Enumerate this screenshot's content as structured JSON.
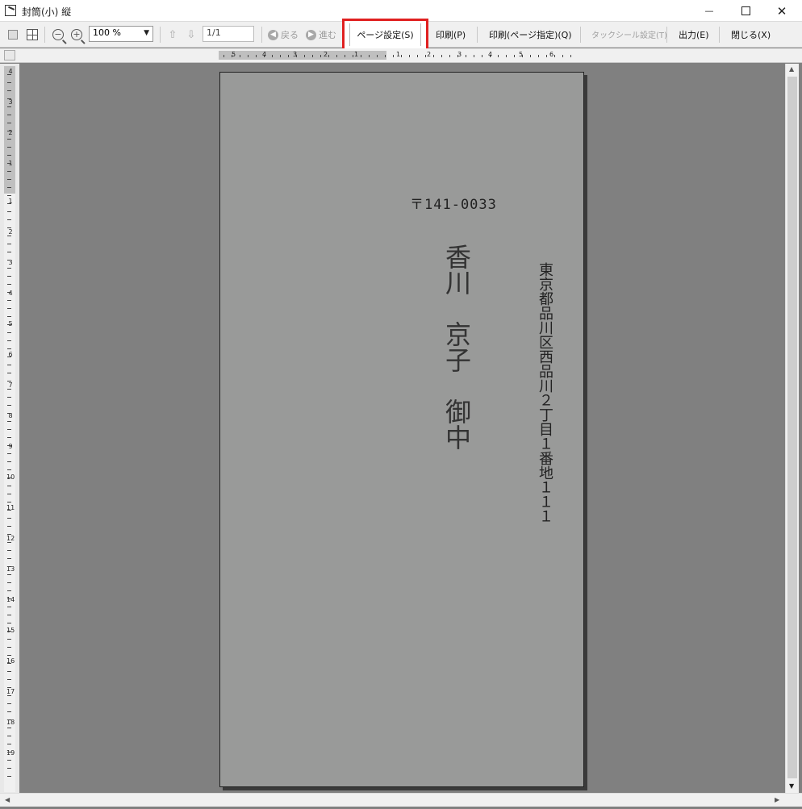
{
  "window": {
    "title": "封筒(小) 縦",
    "minimize": "—",
    "close": "✕"
  },
  "toolbar": {
    "zoom_value": "100 %",
    "page_field": "1/1",
    "back_label": "戻る",
    "forward_label": "進む",
    "page_setup_label": "ページ設定(S)",
    "print_label": "印刷(P)",
    "print_page_label": "印刷(ページ指定)(Q)",
    "tack_seal_label": "タックシール設定(T)",
    "output_label": "出力(E)",
    "close_label": "閉じる(X)"
  },
  "icons": {
    "app": "envelope-app-icon",
    "single_page": "single-page-icon",
    "multi_page": "multi-page-icon",
    "zoom_out": "zoom-out-icon",
    "zoom_in": "zoom-in-icon",
    "prev_page": "prev-page-icon",
    "next_page": "next-page-icon"
  },
  "envelope": {
    "postal_code": "〒141-0033",
    "address": "東京都品川区西品川２丁目１番地１１１",
    "name": "香川　京子　御中"
  },
  "colors": {
    "highlight": "#e02020",
    "page": "#999a99",
    "canvas": "#808080"
  },
  "rulers": {
    "horizontal_labels": [
      "5",
      "4",
      "3",
      "2",
      "1",
      "1",
      "2",
      "3",
      "4",
      "5",
      "6"
    ],
    "vertical_labels": [
      "4",
      "3",
      "2",
      "1",
      "1",
      "2",
      "3",
      "4",
      "5",
      "6",
      "7",
      "8",
      "9",
      "10",
      "11",
      "12",
      "13",
      "14",
      "15",
      "16",
      "17",
      "18",
      "19"
    ]
  }
}
